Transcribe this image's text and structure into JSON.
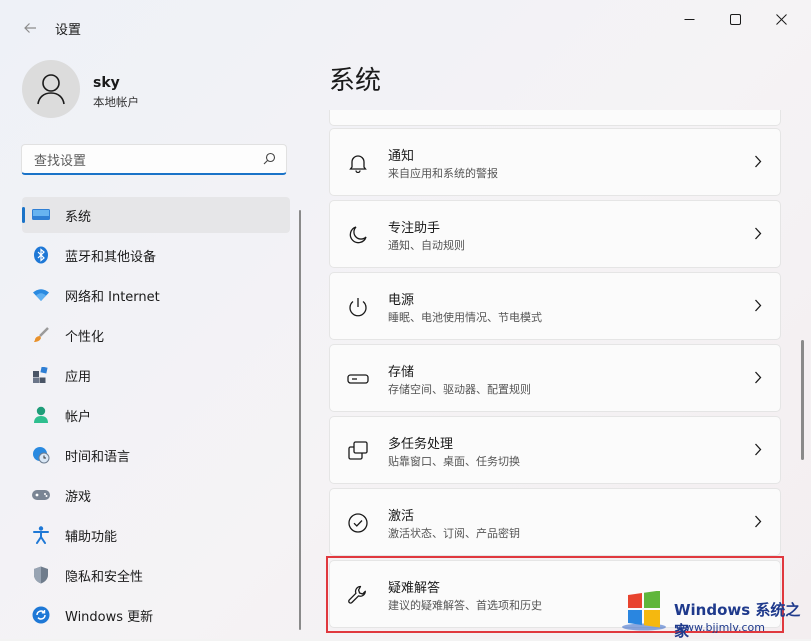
{
  "window": {
    "title": "设置"
  },
  "profile": {
    "name": "sky",
    "account_type": "本地帐户"
  },
  "search": {
    "placeholder": "查找设置"
  },
  "nav": {
    "items": [
      {
        "label": "系统",
        "icon": "monitor-icon",
        "selected": true
      },
      {
        "label": "蓝牙和其他设备",
        "icon": "bluetooth-icon"
      },
      {
        "label": "网络和 Internet",
        "icon": "wifi-icon"
      },
      {
        "label": "个性化",
        "icon": "brush-icon"
      },
      {
        "label": "应用",
        "icon": "apps-icon"
      },
      {
        "label": "帐户",
        "icon": "person-icon"
      },
      {
        "label": "时间和语言",
        "icon": "globe-clock-icon"
      },
      {
        "label": "游戏",
        "icon": "gamepad-icon"
      },
      {
        "label": "辅助功能",
        "icon": "accessibility-icon"
      },
      {
        "label": "隐私和安全性",
        "icon": "shield-icon"
      },
      {
        "label": "Windows 更新",
        "icon": "update-icon"
      }
    ]
  },
  "main": {
    "title": "系统",
    "cards": [
      {
        "title": "通知",
        "subtitle": "来自应用和系统的警报",
        "icon": "bell-icon"
      },
      {
        "title": "专注助手",
        "subtitle": "通知、自动规则",
        "icon": "moon-icon"
      },
      {
        "title": "电源",
        "subtitle": "睡眠、电池使用情况、节电模式",
        "icon": "power-icon"
      },
      {
        "title": "存储",
        "subtitle": "存储空间、驱动器、配置规则",
        "icon": "storage-icon"
      },
      {
        "title": "多任务处理",
        "subtitle": "贴靠窗口、桌面、任务切换",
        "icon": "multitask-icon"
      },
      {
        "title": "激活",
        "subtitle": "激活状态、订阅、产品密钥",
        "icon": "check-circle-icon"
      },
      {
        "title": "疑难解答",
        "subtitle": "建议的疑难解答、首选项和历史",
        "icon": "wrench-icon"
      }
    ]
  },
  "watermark": {
    "title": "Windows 系统之家",
    "url": "www.bjjmlv.com"
  },
  "colors": {
    "accent": "#1a73c8",
    "highlight_border": "#e0383e"
  }
}
